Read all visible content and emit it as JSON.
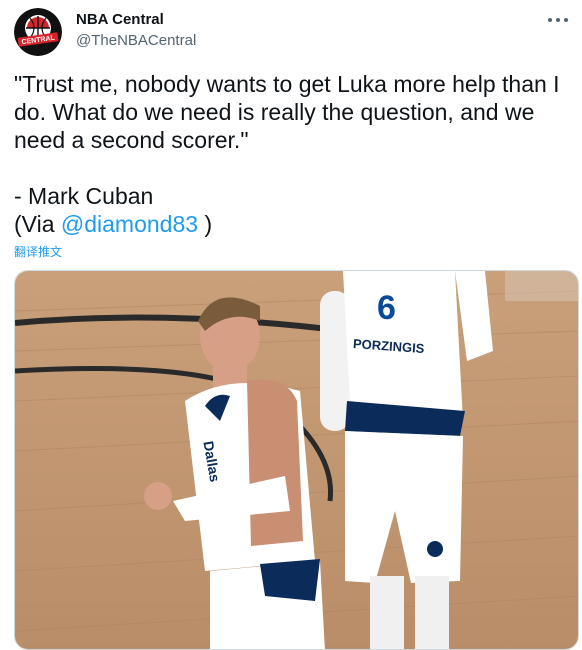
{
  "author": {
    "name": "NBA Central",
    "handle": "@TheNBACentral",
    "avatar_logo_text": "CENTRAL"
  },
  "tweet": {
    "text": "\"Trust me, nobody wants to get Luka more help than I do. What do we need is really the question, and we need a second scorer.\"\n\n- Mark Cuban",
    "via_open": "(Via ",
    "mention": "@diamond83",
    "via_close": " )",
    "translate_label": "翻译推文"
  },
  "media": {
    "jersey_number": "6",
    "jersey_name": "PORZINGIS",
    "jersey_team": "Dallas"
  },
  "icons": {
    "more": "more-horizontal-icon"
  },
  "colors": {
    "text": "#0f1419",
    "secondary": "#536471",
    "link": "#1d9bf0",
    "border": "#cfd9de"
  }
}
